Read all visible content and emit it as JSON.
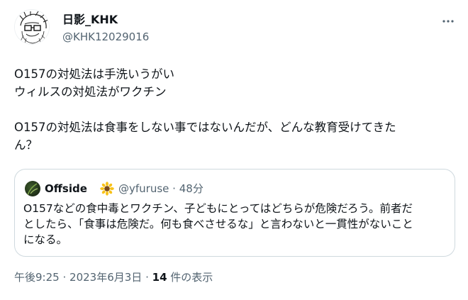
{
  "tweet": {
    "display_name": "日影_KHK",
    "handle": "@KHK12029016",
    "more_icon": "more-dots-icon",
    "text_lines": [
      "O157の対処法は手洗いうがい",
      "ウィルスの対処法がワクチン",
      "",
      "O157の対処法は食事をしない事ではないんだが、どんな教育受けてきた",
      "ん？"
    ]
  },
  "quote": {
    "display_name": "Offside",
    "badge_icon": "sunflower-icon",
    "handle": "@yfuruse",
    "separator": "·",
    "time": "48分",
    "text_lines": [
      "O157などの食中毒とワクチン、子どもにとってはどちらが危険だろう。前者だ",
      "としたら、「食事は危険だ。何も食べさせるな」と言わないと一貫性がないこと",
      "になる。"
    ]
  },
  "meta": {
    "time": "午後9:25",
    "sep1": "·",
    "date": "2023年6月3日",
    "sep2": "·",
    "view_count": "14",
    "view_label": "件の表示"
  },
  "colors": {
    "text": "#0f1419",
    "secondary": "#536471",
    "border": "#cfd9de"
  }
}
